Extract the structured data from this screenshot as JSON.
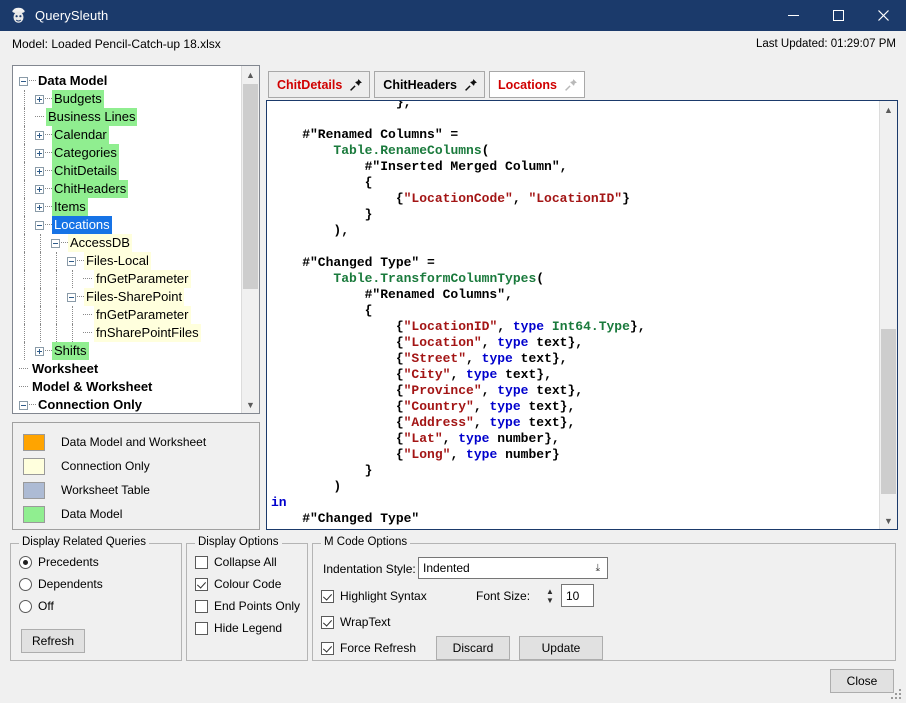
{
  "window": {
    "title": "QuerySleuth",
    "icon": "sleuth-icon",
    "minimize_label": "─",
    "maximize_label": "☐",
    "close_label": "✕"
  },
  "header": {
    "model_label": "Model: Loaded Pencil-Catch-up 18.xlsx",
    "last_updated": "Last Updated: 01:29:07 PM"
  },
  "tree": {
    "nodes": [
      {
        "label": "Data Model",
        "depth": 0,
        "toggle": "minus",
        "style": "none",
        "bold": true
      },
      {
        "label": "Budgets",
        "depth": 1,
        "toggle": "plus",
        "style": "model",
        "bold": false
      },
      {
        "label": "Business Lines",
        "depth": 1,
        "toggle": "leaf",
        "style": "model",
        "bold": false
      },
      {
        "label": "Calendar",
        "depth": 1,
        "toggle": "plus",
        "style": "model",
        "bold": false
      },
      {
        "label": "Categories",
        "depth": 1,
        "toggle": "plus",
        "style": "model",
        "bold": false
      },
      {
        "label": "ChitDetails",
        "depth": 1,
        "toggle": "plus",
        "style": "model",
        "bold": false
      },
      {
        "label": "ChitHeaders",
        "depth": 1,
        "toggle": "plus",
        "style": "model",
        "bold": false
      },
      {
        "label": "Items",
        "depth": 1,
        "toggle": "plus",
        "style": "model",
        "bold": false
      },
      {
        "label": "Locations",
        "depth": 1,
        "toggle": "minus",
        "style": "sel",
        "bold": false
      },
      {
        "label": "AccessDB",
        "depth": 2,
        "toggle": "minus",
        "style": "conn",
        "bold": false
      },
      {
        "label": "Files-Local",
        "depth": 3,
        "toggle": "minus",
        "style": "conn",
        "bold": false
      },
      {
        "label": "fnGetParameter",
        "depth": 4,
        "toggle": "leaf",
        "style": "conn",
        "bold": false
      },
      {
        "label": "Files-SharePoint",
        "depth": 3,
        "toggle": "minus",
        "style": "conn",
        "bold": false
      },
      {
        "label": "fnGetParameter",
        "depth": 4,
        "toggle": "leaf",
        "style": "conn",
        "bold": false
      },
      {
        "label": "fnSharePointFiles",
        "depth": 4,
        "toggle": "leaf",
        "style": "conn",
        "bold": false
      },
      {
        "label": "Shifts",
        "depth": 1,
        "toggle": "plus",
        "style": "model",
        "bold": false
      },
      {
        "label": "Worksheet",
        "depth": 0,
        "toggle": "leaf",
        "style": "none",
        "bold": true
      },
      {
        "label": "Model & Worksheet",
        "depth": 0,
        "toggle": "leaf",
        "style": "none",
        "bold": true
      },
      {
        "label": "Connection Only",
        "depth": 0,
        "toggle": "minus",
        "style": "none",
        "bold": true
      }
    ]
  },
  "legend": {
    "items": [
      {
        "label": "Data Model and Worksheet",
        "color": "#ffa400"
      },
      {
        "label": "Connection Only",
        "color": "#ffffdd"
      },
      {
        "label": "Worksheet Table",
        "color": "#adbbd4"
      },
      {
        "label": "Data Model",
        "color": "#90ee90"
      }
    ]
  },
  "related_queries": {
    "title": "Display Related Queries",
    "options": [
      {
        "label": "Precedents",
        "selected": true
      },
      {
        "label": "Dependents",
        "selected": false
      },
      {
        "label": "Off",
        "selected": false
      }
    ],
    "refresh_label": "Refresh"
  },
  "display_options": {
    "title": "Display Options",
    "items": [
      {
        "label": "Collapse All",
        "checked": false
      },
      {
        "label": "Colour Code",
        "checked": true
      },
      {
        "label": "End Points Only",
        "checked": false
      },
      {
        "label": "Hide Legend",
        "checked": false
      }
    ]
  },
  "mcode_options": {
    "title": "M Code Options",
    "indentation_label": "Indentation Style:",
    "indentation_value": "Indented",
    "font_size_label": "Font Size:",
    "font_size_value": "10",
    "items": [
      {
        "label": "Highlight Syntax",
        "checked": true
      },
      {
        "label": "WrapText",
        "checked": true
      },
      {
        "label": "Force Refresh",
        "checked": true
      }
    ],
    "discard_label": "Discard",
    "update_label": "Update"
  },
  "tabs": [
    {
      "label": "ChitDetails",
      "active": false,
      "color": "red",
      "pinned": true
    },
    {
      "label": "ChitHeaders",
      "active": false,
      "color": "black",
      "pinned": true
    },
    {
      "label": "Locations",
      "active": true,
      "color": "red",
      "pinned": false
    }
  ],
  "code": {
    "lines": [
      [
        {
          "t": "                },",
          "c": "plain"
        }
      ],
      [
        {
          "t": "",
          "c": "plain"
        }
      ],
      [
        {
          "t": "    #\"Renamed Columns\" = ",
          "c": "plain"
        }
      ],
      [
        {
          "t": "        ",
          "c": "plain"
        },
        {
          "t": "Table.RenameColumns",
          "c": "func"
        },
        {
          "t": "(",
          "c": "plain"
        }
      ],
      [
        {
          "t": "            #\"Inserted Merged Column\",",
          "c": "plain"
        }
      ],
      [
        {
          "t": "            {",
          "c": "plain"
        }
      ],
      [
        {
          "t": "                {",
          "c": "plain"
        },
        {
          "t": "\"LocationCode\"",
          "c": "str"
        },
        {
          "t": ", ",
          "c": "plain"
        },
        {
          "t": "\"LocationID\"",
          "c": "str"
        },
        {
          "t": "}",
          "c": "plain"
        }
      ],
      [
        {
          "t": "            }",
          "c": "plain"
        }
      ],
      [
        {
          "t": "        ),",
          "c": "plain"
        }
      ],
      [
        {
          "t": "",
          "c": "plain"
        }
      ],
      [
        {
          "t": "    #\"Changed Type\" = ",
          "c": "plain"
        }
      ],
      [
        {
          "t": "        ",
          "c": "plain"
        },
        {
          "t": "Table.TransformColumnTypes",
          "c": "func"
        },
        {
          "t": "(",
          "c": "plain"
        }
      ],
      [
        {
          "t": "            #\"Renamed Columns\",",
          "c": "plain"
        }
      ],
      [
        {
          "t": "            {",
          "c": "plain"
        }
      ],
      [
        {
          "t": "                {",
          "c": "plain"
        },
        {
          "t": "\"LocationID\"",
          "c": "str"
        },
        {
          "t": ", ",
          "c": "plain"
        },
        {
          "t": "type",
          "c": "kw"
        },
        {
          "t": " ",
          "c": "plain"
        },
        {
          "t": "Int64.Type",
          "c": "type"
        },
        {
          "t": "},",
          "c": "plain"
        }
      ],
      [
        {
          "t": "                {",
          "c": "plain"
        },
        {
          "t": "\"Location\"",
          "c": "str"
        },
        {
          "t": ", ",
          "c": "plain"
        },
        {
          "t": "type",
          "c": "kw"
        },
        {
          "t": " text},",
          "c": "plain"
        }
      ],
      [
        {
          "t": "                {",
          "c": "plain"
        },
        {
          "t": "\"Street\"",
          "c": "str"
        },
        {
          "t": ", ",
          "c": "plain"
        },
        {
          "t": "type",
          "c": "kw"
        },
        {
          "t": " text},",
          "c": "plain"
        }
      ],
      [
        {
          "t": "                {",
          "c": "plain"
        },
        {
          "t": "\"City\"",
          "c": "str"
        },
        {
          "t": ", ",
          "c": "plain"
        },
        {
          "t": "type",
          "c": "kw"
        },
        {
          "t": " text},",
          "c": "plain"
        }
      ],
      [
        {
          "t": "                {",
          "c": "plain"
        },
        {
          "t": "\"Province\"",
          "c": "str"
        },
        {
          "t": ", ",
          "c": "plain"
        },
        {
          "t": "type",
          "c": "kw"
        },
        {
          "t": " text},",
          "c": "plain"
        }
      ],
      [
        {
          "t": "                {",
          "c": "plain"
        },
        {
          "t": "\"Country\"",
          "c": "str"
        },
        {
          "t": ", ",
          "c": "plain"
        },
        {
          "t": "type",
          "c": "kw"
        },
        {
          "t": " text},",
          "c": "plain"
        }
      ],
      [
        {
          "t": "                {",
          "c": "plain"
        },
        {
          "t": "\"Address\"",
          "c": "str"
        },
        {
          "t": ", ",
          "c": "plain"
        },
        {
          "t": "type",
          "c": "kw"
        },
        {
          "t": " text},",
          "c": "plain"
        }
      ],
      [
        {
          "t": "                {",
          "c": "plain"
        },
        {
          "t": "\"Lat\"",
          "c": "str"
        },
        {
          "t": ", ",
          "c": "plain"
        },
        {
          "t": "type",
          "c": "kw"
        },
        {
          "t": " number},",
          "c": "plain"
        }
      ],
      [
        {
          "t": "                {",
          "c": "plain"
        },
        {
          "t": "\"Long\"",
          "c": "str"
        },
        {
          "t": ", ",
          "c": "plain"
        },
        {
          "t": "type",
          "c": "kw"
        },
        {
          "t": " number}",
          "c": "plain"
        }
      ],
      [
        {
          "t": "            }",
          "c": "plain"
        }
      ],
      [
        {
          "t": "        )",
          "c": "plain"
        }
      ],
      [
        {
          "t": "in",
          "c": "kw"
        }
      ],
      [
        {
          "t": "    #\"Changed Type\"",
          "c": "plain"
        }
      ]
    ]
  },
  "footer": {
    "close_label": "Close"
  }
}
